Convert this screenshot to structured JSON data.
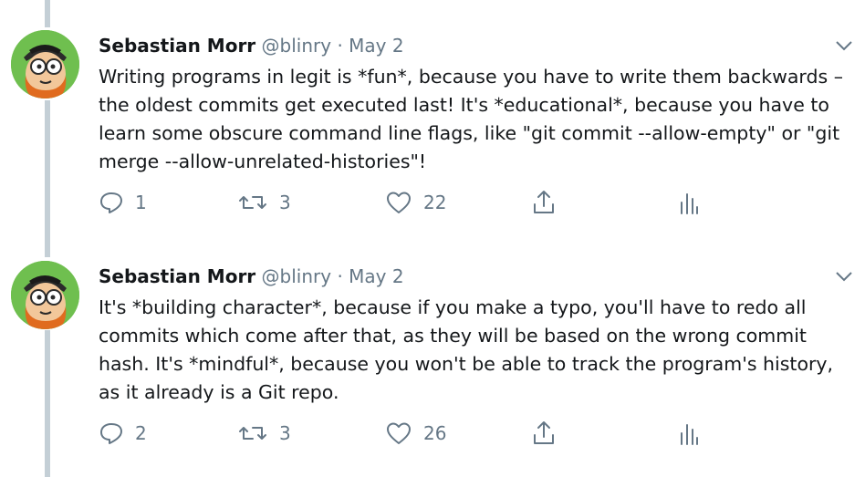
{
  "tweets": [
    {
      "author": {
        "name": "Sebastian Morr",
        "handle": "@blinry"
      },
      "separator": "·",
      "date": "May 2",
      "text": "Writing programs in legit is *fun*, because you have to write them backwards – the oldest commits get executed last! It's *educational*, because you have to learn some obscure command line flags, like \"git commit --allow-empty\" or \"git merge --allow-unrelated-histories\"!",
      "actions": {
        "replies": "1",
        "retweets": "3",
        "likes": "22"
      },
      "icons": [
        "reply-icon",
        "retweet-icon",
        "like-icon",
        "share-icon",
        "analytics-icon",
        "chevron-down-icon"
      ]
    },
    {
      "author": {
        "name": "Sebastian Morr",
        "handle": "@blinry"
      },
      "separator": "·",
      "date": "May 2",
      "text": "It's *building character*, because if you make a typo, you'll have to redo all commits which come after that, as they will be based on the wrong commit hash. It's *mindful*, because you won't be able to track the program's history, as it already is a Git repo.",
      "actions": {
        "replies": "2",
        "retweets": "3",
        "likes": "26"
      },
      "icons": [
        "reply-icon",
        "retweet-icon",
        "like-icon",
        "share-icon",
        "analytics-icon",
        "chevron-down-icon"
      ]
    }
  ],
  "colors": {
    "text": "#14171a",
    "secondary": "#657786",
    "thread_line": "#c4cfd6",
    "avatar_bg": "#6fbf4f"
  }
}
